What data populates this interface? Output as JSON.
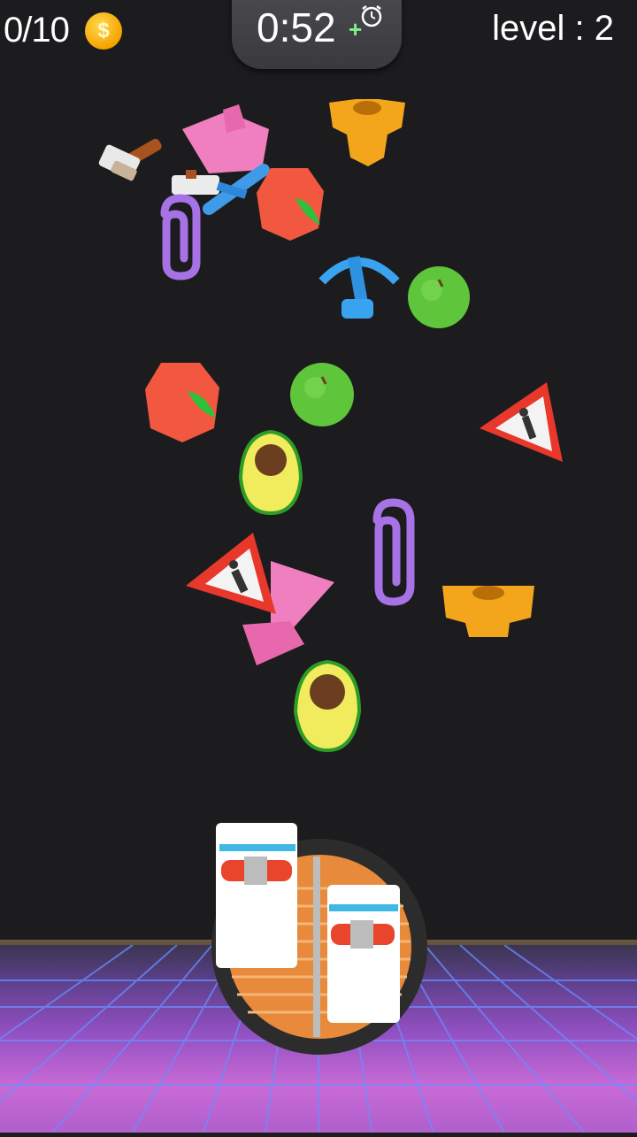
{
  "hud": {
    "coins": "0/10",
    "coin_symbol": "$",
    "timer": "0:52",
    "timer_plus": "+",
    "level": "level : 2"
  },
  "colors": {
    "background": "#1c1c1f",
    "coin": "#f5a300",
    "timer_panel": "#434347",
    "floor_grid": "#6a8cff",
    "floor": "#8f4fc0"
  },
  "objects": [
    {
      "name": "axe-toy"
    },
    {
      "name": "pink-hat-toy"
    },
    {
      "name": "golden-armor-toy"
    },
    {
      "name": "blue-crossbow-toy"
    },
    {
      "name": "orange-fruit"
    },
    {
      "name": "purple-paperclip"
    },
    {
      "name": "green-apple"
    },
    {
      "name": "warning-sign"
    },
    {
      "name": "avocado"
    },
    {
      "name": "pink-cone"
    },
    {
      "name": "golden-corset"
    },
    {
      "name": "ambulance-toy"
    }
  ]
}
